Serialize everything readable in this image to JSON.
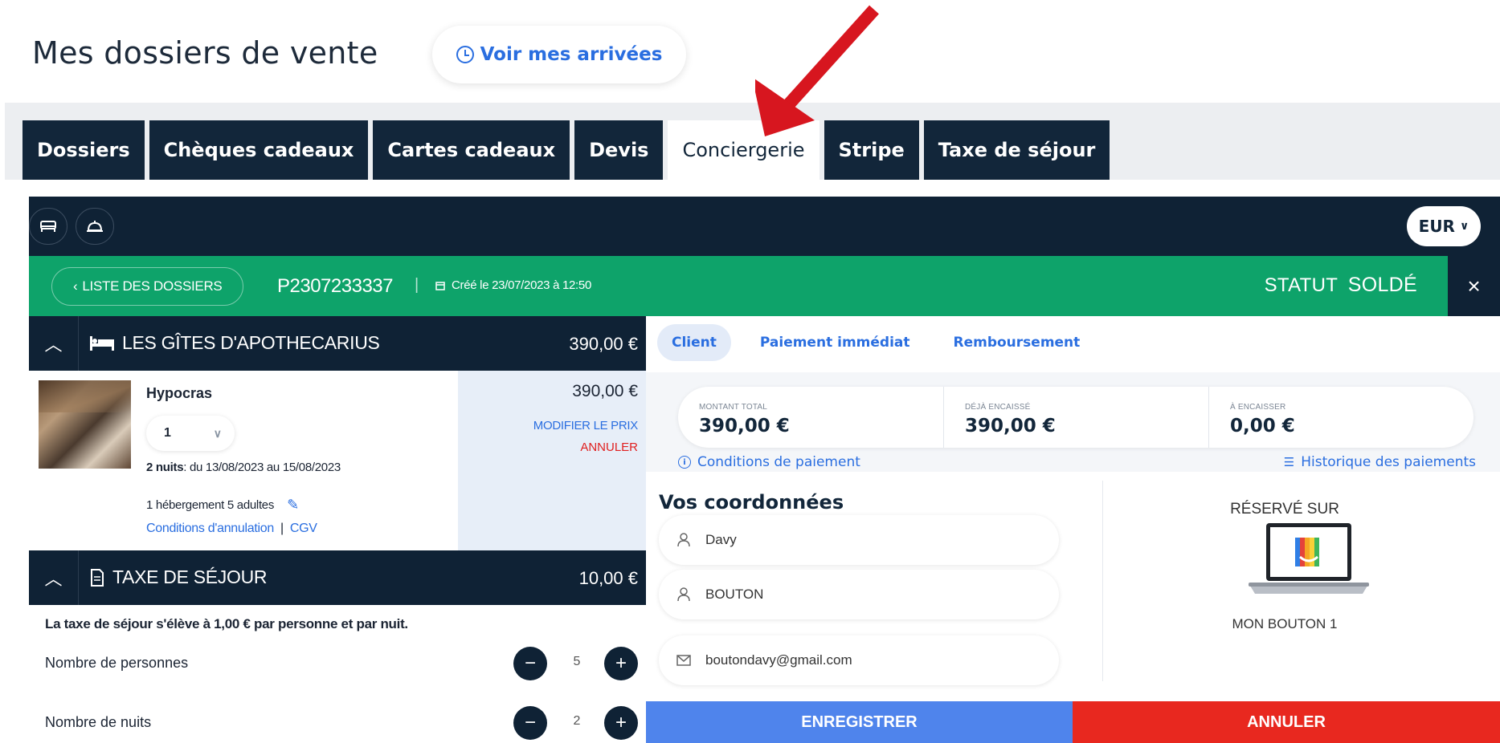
{
  "header": {
    "title": "Mes dossiers de vente",
    "arrivals_button": "Voir mes arrivées"
  },
  "tabs": [
    {
      "label": "Dossiers"
    },
    {
      "label": "Chèques cadeaux"
    },
    {
      "label": "Cartes cadeaux"
    },
    {
      "label": "Devis"
    },
    {
      "label": "Conciergerie"
    },
    {
      "label": "Stripe"
    },
    {
      "label": "Taxe de séjour"
    }
  ],
  "active_tab": "Conciergerie",
  "panel": {
    "currency": "EUR",
    "list_button": "LISTE DES DOSSIERS",
    "reference": "P2307233337",
    "separator": "|",
    "created": "Créé le 23/07/2023 à 12:50",
    "status_label": "STATUT",
    "status_value": "SOLDÉ",
    "close": "×"
  },
  "left": {
    "lodging_section": {
      "title": "LES GÎTES D'APOTHECARIUS",
      "amount": "390,00 €"
    },
    "item": {
      "name": "Hypocras",
      "quantity": "1",
      "nights_bold": "2 nuits",
      "nights_rest": ": du 13/08/2023 au 15/08/2023",
      "lodging_detail": "1 hébergement 5 adultes",
      "cancellation_link": "Conditions d'annulation",
      "links_separator": "|",
      "cgv_link": "CGV",
      "price": "390,00 €",
      "modify_price": "MODIFIER LE PRIX",
      "cancel": "ANNULER"
    },
    "tax_section": {
      "title": "TAXE DE SÉJOUR",
      "amount": "10,00 €",
      "note": "La taxe de séjour s'élève à 1,00 € par personne et par nuit.",
      "rows": [
        {
          "label": "Nombre de personnes",
          "value": "5"
        },
        {
          "label": "Nombre de nuits",
          "value": "2"
        }
      ]
    }
  },
  "right": {
    "tabs": [
      {
        "label": "Client"
      },
      {
        "label": "Paiement immédiat"
      },
      {
        "label": "Remboursement"
      }
    ],
    "active_tab": "Client",
    "summary": [
      {
        "caption": "MONTANT TOTAL",
        "value": "390,00 €"
      },
      {
        "caption": "DÉJÀ ENCAISSÉ",
        "value": "390,00 €"
      },
      {
        "caption": "À ENCAISSER",
        "value": "0,00 €"
      }
    ],
    "payment_conditions": "Conditions de paiement",
    "payment_history": "Historique des paiements",
    "coords_title": "Vos coordonnées",
    "fields": {
      "first_name": "Davy",
      "last_name": "BOUTON",
      "email": "boutondavy@gmail.com"
    },
    "reserved_on": "RÉSERVÉ SUR",
    "channel": "MON BOUTON 1",
    "save_button": "ENREGISTRER",
    "cancel_button": "ANNULER"
  },
  "colors": {
    "navy": "#0f2235",
    "green": "#0ea36a",
    "blue": "#2a6ee0",
    "save": "#4f84ec",
    "cancel": "#e8281f",
    "arrow": "#d7161f"
  }
}
